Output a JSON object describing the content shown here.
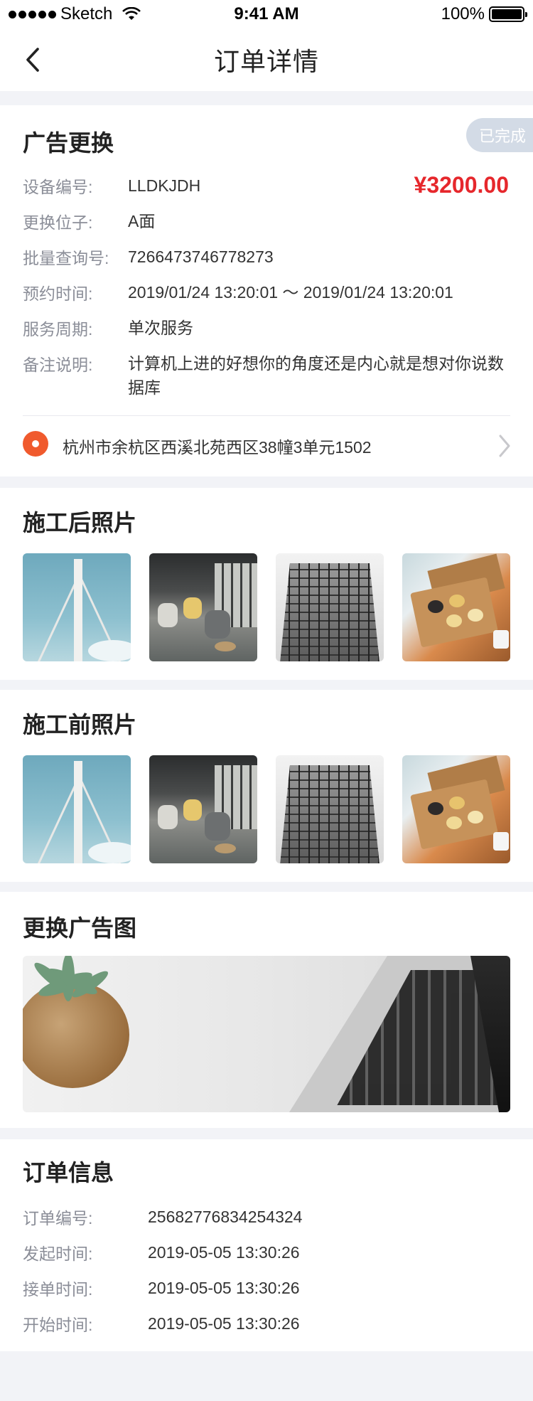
{
  "status_bar": {
    "carrier": "Sketch",
    "time": "9:41 AM",
    "battery": "100%"
  },
  "nav": {
    "title": "订单详情"
  },
  "order": {
    "title": "广告更换",
    "status": "已完成",
    "price": "¥3200.00",
    "fields": [
      {
        "label": "设备编号:",
        "value": "LLDKJDH"
      },
      {
        "label": "更换位子:",
        "value": "A面"
      },
      {
        "label": "批量查询号:",
        "value": "7266473746778273"
      },
      {
        "label": "预约时间:",
        "value": "2019/01/24 13:20:01 ～ 2019/01/24 13:20:01"
      },
      {
        "label": "服务周期:",
        "value": "单次服务"
      },
      {
        "label": "备注说明:",
        "value": "计算机上进的好想你的角度还是内心就是想对你说数据库"
      }
    ],
    "address": "杭州市余杭区西溪北苑西区38幢3单元1502"
  },
  "after_photos": {
    "title": "施工后照片",
    "photos": [
      "bridge-photo",
      "interior-photo",
      "building-photo",
      "food-box-photo"
    ]
  },
  "before_photos": {
    "title": "施工前照片",
    "photos": [
      "bridge-photo",
      "interior-photo",
      "building-photo",
      "food-box-photo"
    ]
  },
  "ad": {
    "title": "更换广告图"
  },
  "order_info": {
    "title": "订单信息",
    "fields": [
      {
        "label": "订单编号:",
        "value": "25682776834254324"
      },
      {
        "label": "发起时间:",
        "value": "2019-05-05 13:30:26"
      },
      {
        "label": "接单时间:",
        "value": "2019-05-05 13:30:26"
      },
      {
        "label": "开始时间:",
        "value": "2019-05-05 13:30:26"
      }
    ]
  },
  "colors": {
    "price": "#e6272c",
    "badge": "#d3dbe6",
    "location": "#f05a2d",
    "background": "#f2f3f7"
  }
}
